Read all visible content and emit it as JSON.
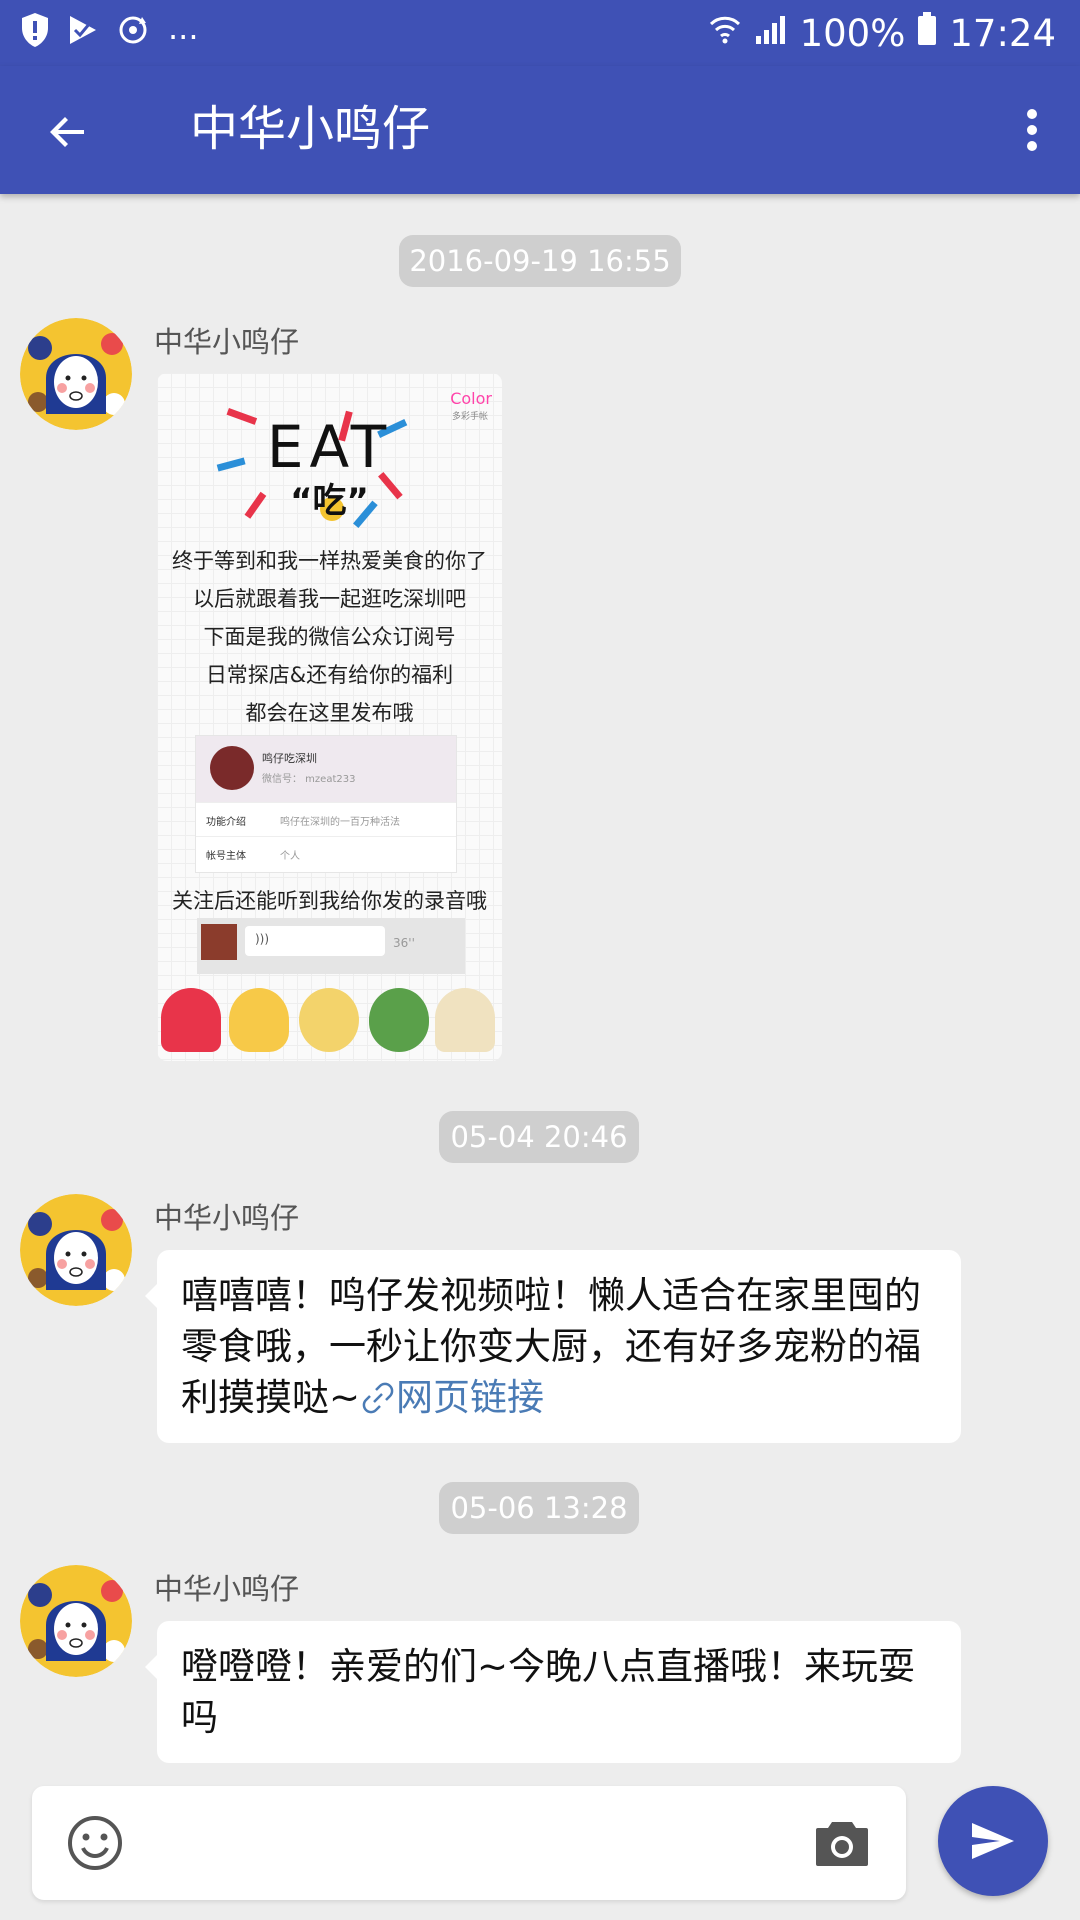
{
  "status_bar": {
    "battery": "100%",
    "time": "17:24",
    "overflow": "...",
    "left_icons": [
      "shield-alert-icon",
      "play-check-icon",
      "sync-icon"
    ],
    "right_icons": [
      "wifi-icon",
      "signal-icon",
      "battery-icon"
    ]
  },
  "app_bar": {
    "title": "中华小鸣仔",
    "back_icon": "arrow-back-icon",
    "menu_icon": "more-vert-icon",
    "color": "#3f51b5"
  },
  "messages": [
    {
      "timestamp": "2016-09-19 16:55",
      "sender": "中华小鸣仔",
      "type": "image",
      "image": {
        "brand": "Color",
        "brand_sub": "多彩手帐",
        "headline": "EAT",
        "headline_sub": "“吃”",
        "lines": [
          "终于等到和我一样热爱美食的你了",
          "以后就跟着我一起逛吃深圳吧",
          "下面是我的微信公众订阅号",
          "日常探店&还有给你的福利",
          "都会在这里发布哦"
        ],
        "card": {
          "name": "鸣仔吃深圳",
          "wechat_id": "微信号： mzeat233",
          "rows": [
            {
              "label": "功能介绍",
              "value": "鸣仔在深圳的一百万种活法"
            },
            {
              "label": "帐号主体",
              "value": "个人"
            }
          ]
        },
        "footer_line": "关注后还能听到我给你发的录音哦",
        "voice_duration": "36''"
      }
    },
    {
      "timestamp": "05-04 20:46",
      "sender": "中华小鸣仔",
      "type": "text",
      "text": "嘻嘻嘻！鸣仔发视频啦！懒人适合在家里囤的零食哦，一秒让你变大厨，还有好多宠粉的福利摸摸哒~",
      "link_label": "网页链接"
    },
    {
      "timestamp": "05-06 13:28",
      "sender": "中华小鸣仔",
      "type": "text",
      "text": "噔噔噔！亲爱的们~今晚八点直播哦！来玩耍吗"
    }
  ],
  "input": {
    "placeholder": "",
    "emoji_icon": "emoji-icon",
    "camera_icon": "camera-icon",
    "send_icon": "send-icon"
  }
}
